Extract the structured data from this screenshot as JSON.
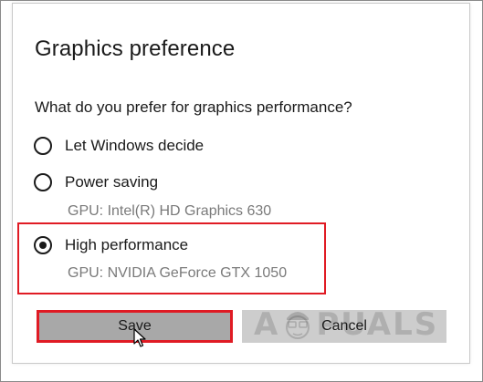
{
  "dialog": {
    "title": "Graphics preference",
    "question": "What do you prefer for graphics performance?",
    "options": [
      {
        "label": "Let Windows decide",
        "checked": false
      },
      {
        "label": "Power saving",
        "checked": false,
        "gpu": "GPU: Intel(R) HD Graphics 630"
      },
      {
        "label": "High performance",
        "checked": true,
        "gpu": "GPU: NVIDIA GeForce GTX 1050"
      }
    ],
    "buttons": {
      "save": "Save",
      "cancel": "Cancel"
    }
  },
  "watermark": {
    "text_left": "A",
    "text_right": "PUALS"
  },
  "colors": {
    "highlight": "#e01b24",
    "save_bg": "#a8a8a8",
    "cancel_bg": "#cdcdcd",
    "secondary_text": "#7a7a7a"
  }
}
